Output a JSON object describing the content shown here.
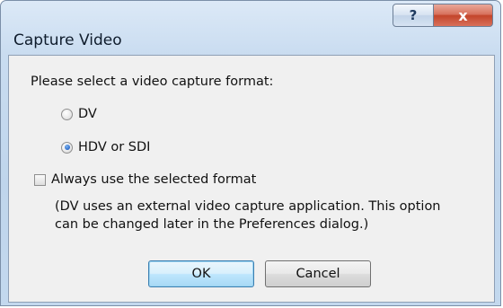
{
  "window": {
    "title": "Capture Video",
    "help_label": "?",
    "close_label": "x"
  },
  "dialog": {
    "prompt": "Please select a video capture format:",
    "options": [
      {
        "label": "DV",
        "selected": false
      },
      {
        "label": "HDV or SDI",
        "selected": true
      }
    ],
    "always_use_label": "Always use the selected format",
    "always_use_checked": false,
    "note_line1": "(DV uses an external video capture application. This option",
    "note_line2": "can be changed later in the Preferences dialog.)"
  },
  "buttons": {
    "ok": "OK",
    "cancel": "Cancel"
  }
}
